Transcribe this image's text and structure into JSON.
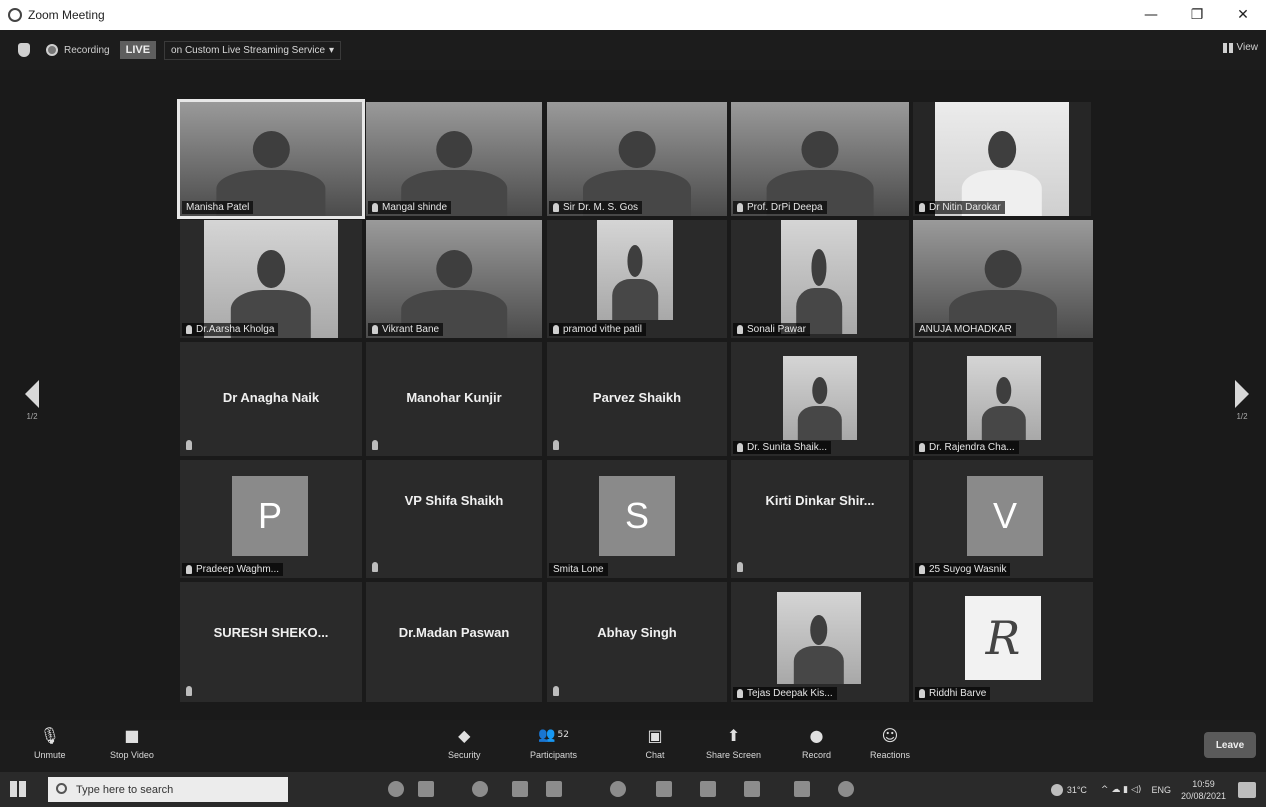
{
  "window": {
    "title": "Zoom Meeting",
    "minimize": "—",
    "maximize": "❐",
    "close": "✕"
  },
  "topbar": {
    "recording_label": "Recording",
    "live_label": "LIVE",
    "stream_label": "on Custom Live Streaming Service",
    "view_label": "View"
  },
  "participants": {
    "row1": [
      {
        "name": "Manisha Patel"
      },
      {
        "name": "Mangal shinde"
      },
      {
        "name": "Sir Dr. M. S. Gos"
      },
      {
        "name": "Prof. DrPi Deepa"
      },
      {
        "name": "Dr Nitin Darokar"
      }
    ],
    "row2": [
      {
        "name": "Dr.Aarsha Kholga"
      },
      {
        "name": "Vikrant Bane"
      },
      {
        "name": "pramod vithe patil"
      },
      {
        "name": "Sonali Pawar"
      },
      {
        "name": "ANUJA MOHADKAR"
      }
    ],
    "row3": [
      {
        "name": "Dr Anagha Naik"
      },
      {
        "name": "Manohar Kunjir"
      },
      {
        "name": "Parvez Shaikh"
      },
      {
        "name": "Dr. Sunita Shaik..."
      },
      {
        "name": "Dr. Rajendra Cha..."
      }
    ],
    "row4": [
      {
        "name": "Pradeep Waghm...",
        "initial": "P"
      },
      {
        "name": "VP Shifa Shaikh"
      },
      {
        "name": "Smita Lone",
        "initial": "S"
      },
      {
        "name": "Kirti Dinkar Shir..."
      },
      {
        "name": "25 Suyog Wasnik",
        "initial": "V"
      }
    ],
    "row5": [
      {
        "name": "SURESH SHEKO..."
      },
      {
        "name": "Dr.Madan Paswan"
      },
      {
        "name": "Abhay Singh"
      },
      {
        "name": "Tejas Deepak Kis..."
      },
      {
        "name": "Riddhi Barve",
        "initial": "R"
      }
    ]
  },
  "pager": {
    "left": "1/2",
    "right": "1/2"
  },
  "toolbar": {
    "unmute": "Unmute",
    "stop_video": "Stop Video",
    "security": "Security",
    "participants": "Participants",
    "participants_count": "52",
    "chat": "Chat",
    "share_screen": "Share Screen",
    "record": "Record",
    "reactions": "Reactions",
    "leave": "Leave"
  },
  "taskbar": {
    "search_placeholder": "Type here to search",
    "temperature": "31°C",
    "language": "ENG",
    "time": "10:59",
    "date": "20/08/2021"
  }
}
